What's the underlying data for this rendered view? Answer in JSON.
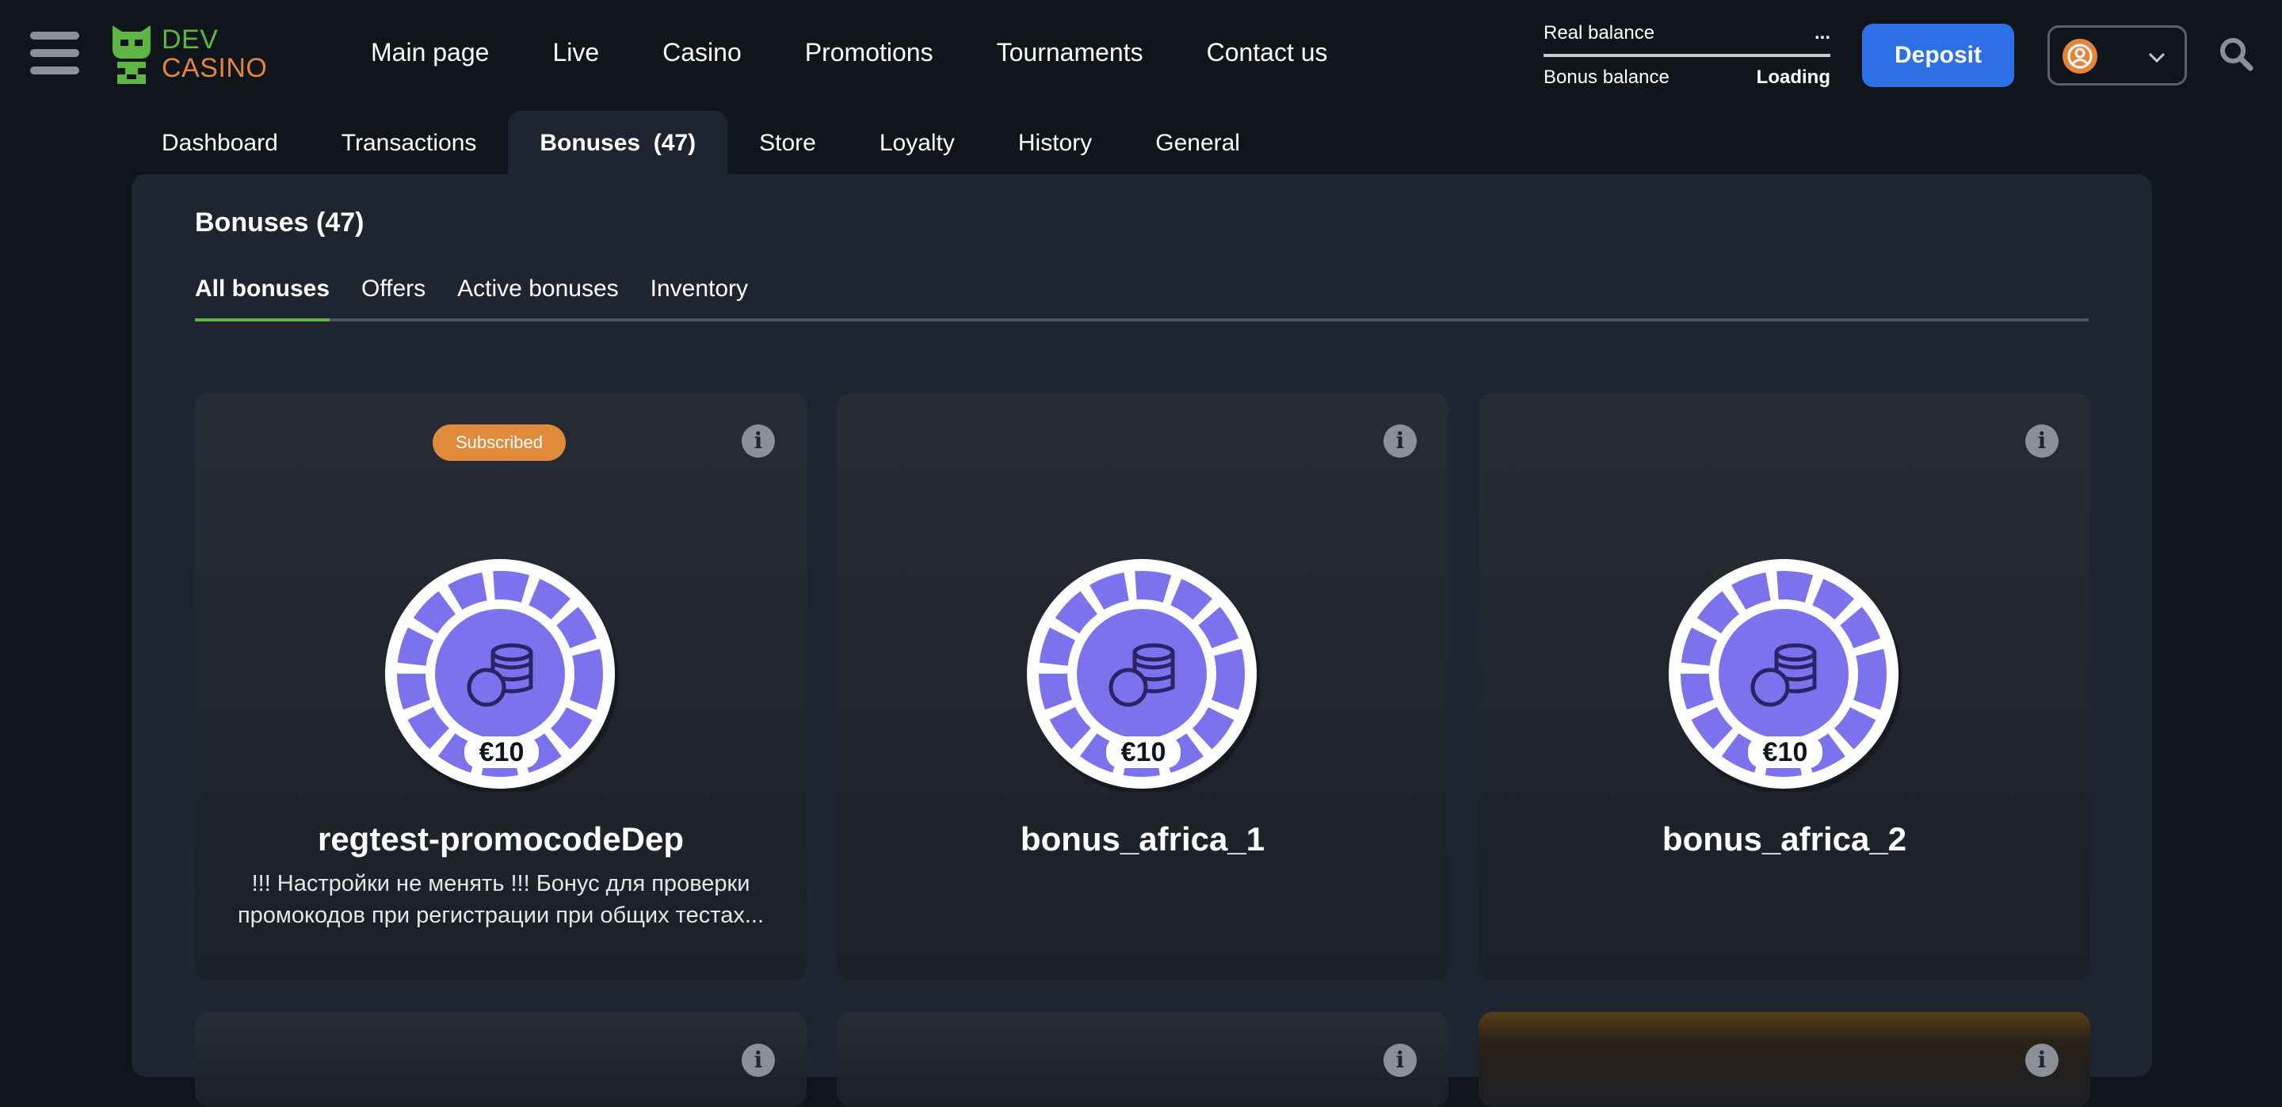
{
  "header": {
    "logo": {
      "line1": "DEV",
      "line2": "CASINO"
    },
    "nav": [
      "Main page",
      "Live",
      "Casino",
      "Promotions",
      "Tournaments",
      "Contact us"
    ],
    "balances": {
      "real_label": "Real balance",
      "real_value": "...",
      "bonus_label": "Bonus balance",
      "bonus_value": "Loading"
    },
    "deposit_label": "Deposit"
  },
  "profile_tabs": [
    "Dashboard",
    "Transactions",
    "Bonuses  (47)",
    "Store",
    "Loyalty",
    "History",
    "General"
  ],
  "panel": {
    "title": "Bonuses (47)",
    "subtabs": [
      "All bonuses",
      "Offers",
      "Active bonuses",
      "Inventory"
    ]
  },
  "cards": [
    {
      "badge": "Subscribed",
      "amount": "€10",
      "name": "regtest-promocodeDep",
      "description": "!!! Настройки не менять !!! Бонус для проверки промокодов при регистрации при общих тестах..."
    },
    {
      "amount": "€10",
      "name": "bonus_africa_1"
    },
    {
      "amount": "€10",
      "name": "bonus_africa_2"
    }
  ],
  "colors": {
    "background": "#10141b",
    "panel": "#1e2430",
    "accent_blue": "#2f6fe6",
    "accent_green": "#5eb544",
    "accent_orange": "#e7843c",
    "chip_purple": "#7c72ee"
  },
  "icons": [
    "menu-icon",
    "logo-icon",
    "user-icon",
    "chevron-down-icon",
    "search-icon",
    "info-icon",
    "coins-icon"
  ]
}
